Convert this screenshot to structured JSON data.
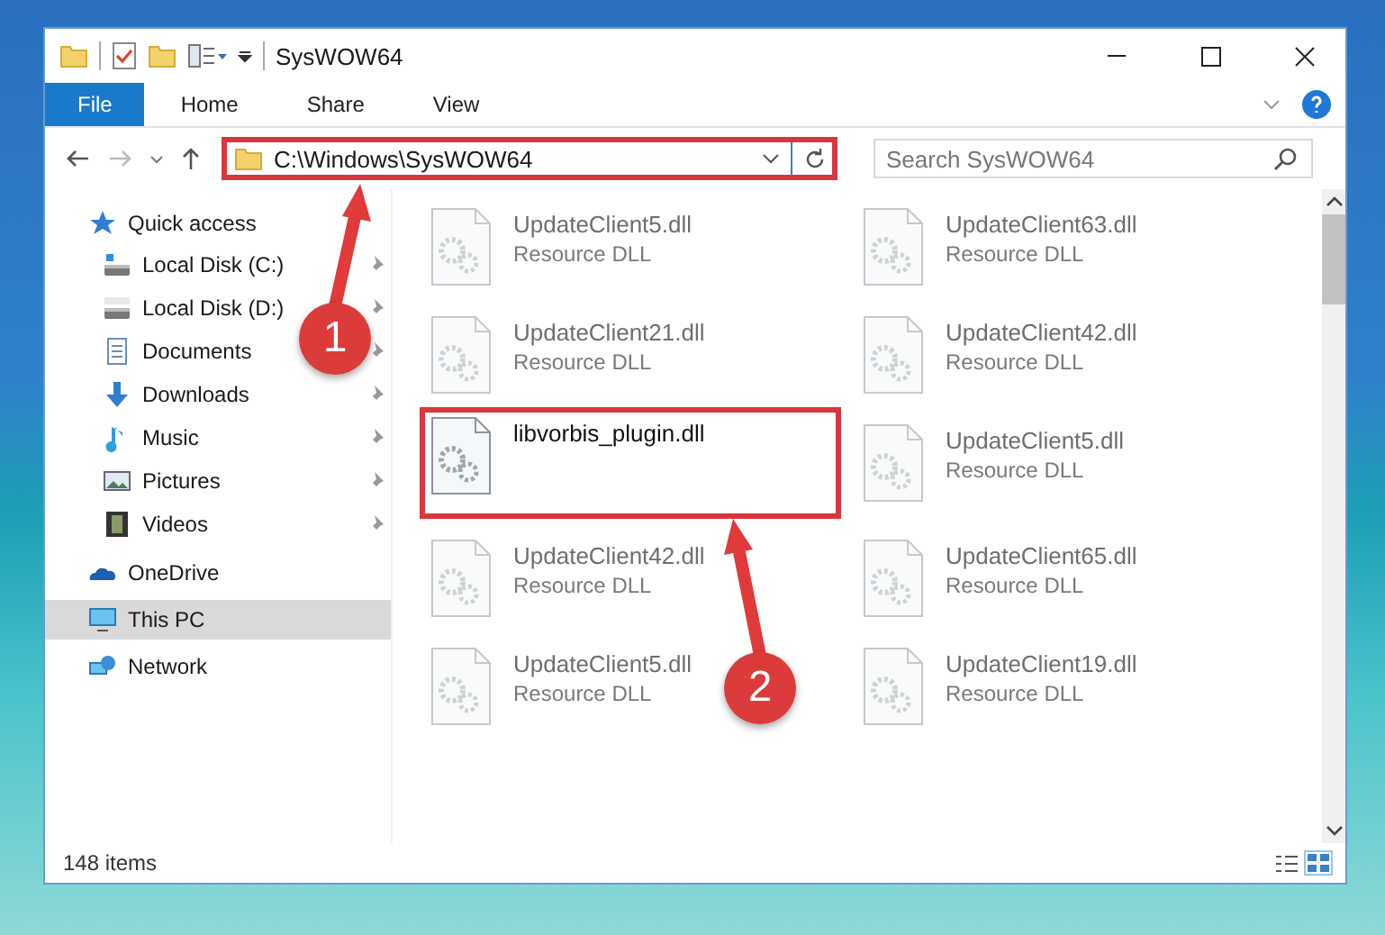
{
  "window": {
    "title": "SysWOW64"
  },
  "ribbon": {
    "tabs": [
      {
        "label": "File",
        "kind": "file",
        "selected": false
      },
      {
        "label": "Home",
        "kind": "tab",
        "selected": false
      },
      {
        "label": "Share",
        "kind": "tab",
        "selected": false
      },
      {
        "label": "View",
        "kind": "tab",
        "selected": false
      }
    ]
  },
  "address_bar": {
    "path": "C:\\Windows\\SysWOW64",
    "highlighted": true
  },
  "search": {
    "placeholder": "Search SysWOW64"
  },
  "sidebar": {
    "items": [
      {
        "label": "Quick access",
        "selected": false,
        "children": [
          {
            "label": "Local Disk (C:)",
            "pinned": true,
            "selected": false
          },
          {
            "label": "Local Disk (D:)",
            "pinned": true,
            "selected": false
          },
          {
            "label": "Documents",
            "pinned": true,
            "selected": false
          },
          {
            "label": "Downloads",
            "pinned": true,
            "selected": false
          },
          {
            "label": "Music",
            "pinned": true,
            "selected": false
          },
          {
            "label": "Pictures",
            "pinned": true,
            "selected": false
          },
          {
            "label": "Videos",
            "pinned": true,
            "selected": false
          }
        ]
      },
      {
        "label": "OneDrive",
        "selected": false
      },
      {
        "label": "This PC",
        "selected": true
      },
      {
        "label": "Network",
        "selected": false
      }
    ]
  },
  "files": [
    {
      "name": "UpdateClient5.dll",
      "type": "Resource DLL",
      "blurred": true,
      "highlighted": false
    },
    {
      "name": "UpdateClient63.dll",
      "type": "Resource DLL",
      "blurred": true,
      "highlighted": false
    },
    {
      "name": "UpdateClient21.dll",
      "type": "Resource DLL",
      "blurred": true,
      "highlighted": false
    },
    {
      "name": "UpdateClient42.dll",
      "type": "Resource DLL",
      "blurred": true,
      "highlighted": false
    },
    {
      "name": "libvorbis_plugin.dll",
      "blurred": false,
      "highlighted": true
    },
    {
      "name": "UpdateClient5.dll",
      "type": "Resource DLL",
      "blurred": true,
      "highlighted": false
    },
    {
      "name": "UpdateClient42.dll",
      "type": "Resource DLL",
      "blurred": true,
      "highlighted": false
    },
    {
      "name": "UpdateClient65.dll",
      "type": "Resource DLL",
      "blurred": true,
      "highlighted": false
    },
    {
      "name": "UpdateClient5.dll",
      "type": "Resource DLL",
      "blurred": true,
      "highlighted": false
    },
    {
      "name": "UpdateClient19.dll",
      "type": "Resource DLL",
      "blurred": true,
      "highlighted": false
    }
  ],
  "status_bar": {
    "count": "148 items"
  },
  "callouts": [
    {
      "number": "1"
    },
    {
      "number": "2"
    }
  ]
}
